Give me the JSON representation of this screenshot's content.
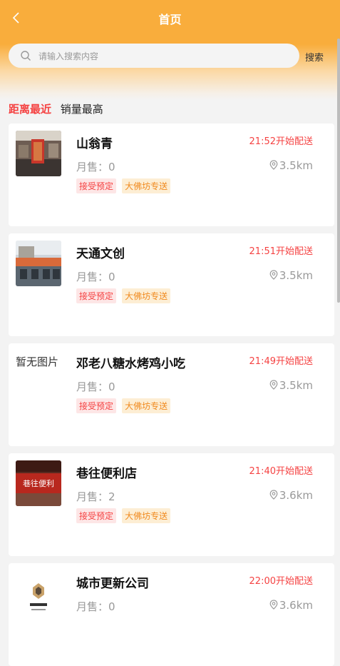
{
  "header": {
    "title": "首页",
    "search_placeholder": "请输入搜索内容",
    "search_button": "搜索"
  },
  "sort_tabs": [
    {
      "label": "距离最近",
      "active": true
    },
    {
      "label": "销量最高",
      "active": false
    }
  ],
  "stores": [
    {
      "name": "山翁青",
      "delivery": "21:52开始配送",
      "sales": "月售：0",
      "distance": "3.5km",
      "tags": [
        "接受预定",
        "大佛坊专送"
      ],
      "thumb": "storefront-photo"
    },
    {
      "name": "天通文创",
      "delivery": "21:51开始配送",
      "sales": "月售：0",
      "distance": "3.5km",
      "tags": [
        "接受预定",
        "大佛坊专送"
      ],
      "thumb": "building-photo"
    },
    {
      "name": "邓老八糖水烤鸡小吃",
      "delivery": "21:49开始配送",
      "sales": "月售：0",
      "distance": "3.5km",
      "tags": [
        "接受预定",
        "大佛坊专送"
      ],
      "no_image": "暂无图片"
    },
    {
      "name": "巷往便利店",
      "delivery": "21:40开始配送",
      "sales": "月售：2",
      "distance": "3.6km",
      "tags": [
        "接受预定",
        "大佛坊专送"
      ],
      "thumb": "shop-sign-photo",
      "sign_text": "巷往便利"
    },
    {
      "name": "城市更新公司",
      "delivery": "22:00开始配送",
      "sales": "月售：0",
      "distance": "3.6km",
      "tags": [],
      "thumb": "logo-image"
    }
  ],
  "colors": {
    "header": "#f9ad3c",
    "accent_red": "#f54242",
    "tag_orange": "#f08a1f"
  }
}
